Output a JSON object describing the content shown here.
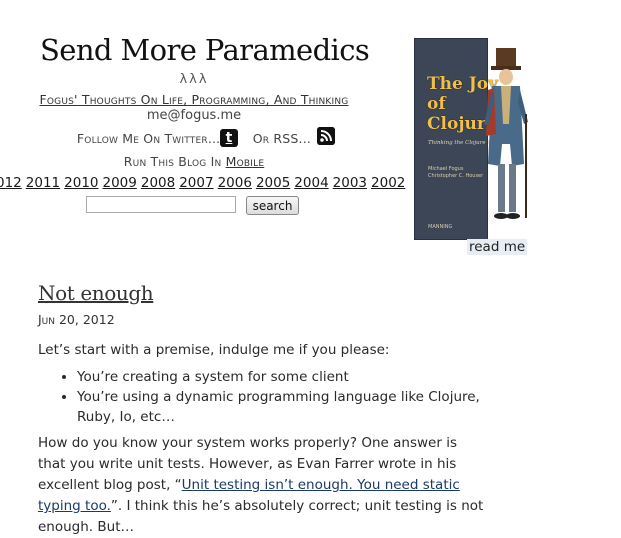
{
  "site": {
    "title": "Send More Paramedics",
    "lambdas": "λλλ",
    "tagline": {
      "author": "Fogus'",
      "thoughts": "Thoughts On Life,",
      "programming": "Programming",
      "and": ", And",
      "thinking": "Thinking"
    },
    "email": "me@fogus.me",
    "follow_label": "Follow Me On Twitter...",
    "or_rss_label": "Or RSS...",
    "run_label": "Run This Blog In",
    "mobile_label": "Mobile",
    "years": [
      "012",
      "2011",
      "2010",
      "2009",
      "2008",
      "2007",
      "2006",
      "2005",
      "2004",
      "2003",
      "2002"
    ],
    "search": {
      "value": "",
      "button_label": "search"
    }
  },
  "book": {
    "title_line1": "The Joy of",
    "title_line2": "Clojure",
    "subtitle": "Thinking the Clojure Way",
    "author1": "Michael Fogus",
    "author2": "Christopher C. Houser",
    "publisher": "MANNING",
    "link_label": "read me"
  },
  "post": {
    "title": "Not enough",
    "date": "Jun 20, 2012",
    "intro": "Let’s start with a premise, indulge me if you please:",
    "bullets": [
      "You’re creating a system for some client",
      "You’re using a dynamic programming language like Clojure, Ruby, Io, etc…"
    ],
    "body_before": "How do you know your system works properly? One answer is that you write unit tests. However, as Evan Farrer wrote in his excellent blog post, “",
    "link_text": "Unit testing isn’t enough. You need static typing too.",
    "body_after": "”. I think this he’s absolutely correct; unit testing is not enough. But…"
  },
  "icons": {
    "twitter": "twitter-icon",
    "rss": "rss-icon"
  }
}
